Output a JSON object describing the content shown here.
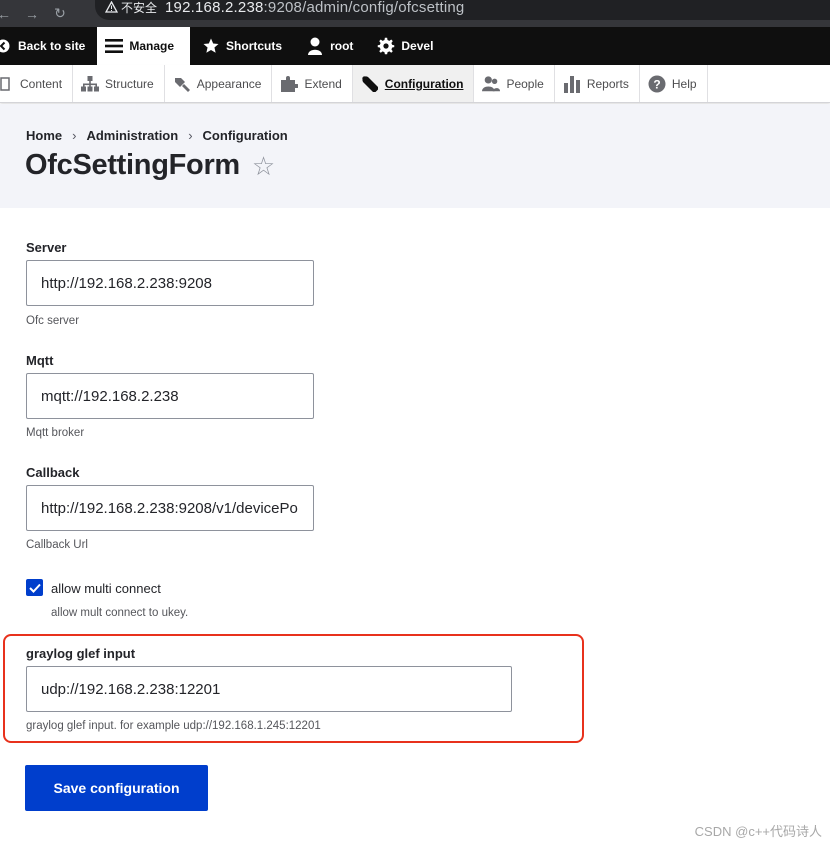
{
  "browser": {
    "security_label": "不安全",
    "url_host": "192.168.2.238",
    "url_path": ":9208/admin/config/ofcsetting"
  },
  "toolbar": {
    "back": "Back to site",
    "manage": "Manage",
    "shortcuts": "Shortcuts",
    "user": "root",
    "devel": "Devel"
  },
  "tray": {
    "items": [
      {
        "label": "Content",
        "icon": "content-icon"
      },
      {
        "label": "Structure",
        "icon": "structure-icon"
      },
      {
        "label": "Appearance",
        "icon": "appearance-icon"
      },
      {
        "label": "Extend",
        "icon": "extend-icon"
      },
      {
        "label": "Configuration",
        "icon": "wrench-icon"
      },
      {
        "label": "People",
        "icon": "people-icon"
      },
      {
        "label": "Reports",
        "icon": "reports-icon"
      },
      {
        "label": "Help",
        "icon": "help-icon"
      }
    ],
    "active": "Configuration"
  },
  "breadcrumb": {
    "home": "Home",
    "sep": "›",
    "administration": "Administration",
    "configuration": "Configuration"
  },
  "page": {
    "title": "OfcSettingForm",
    "star": "☆"
  },
  "form": {
    "server": {
      "label": "Server",
      "value": "http://192.168.2.238:9208",
      "description": "Ofc server"
    },
    "mqtt": {
      "label": "Mqtt",
      "value": "mqtt://192.168.2.238",
      "description": "Mqtt broker"
    },
    "callback": {
      "label": "Callback",
      "value": "http://192.168.2.238:9208/v1/devicePo",
      "description": "Callback Url"
    },
    "multi_connect": {
      "label": "allow multi connect",
      "checked": true,
      "description": "allow mult connect to ukey."
    },
    "graylog": {
      "label": "graylog glef input",
      "value": "udp://192.168.2.238:12201",
      "description": "graylog glef input. for example udp://192.168.1.245:12201"
    },
    "save_label": "Save configuration"
  },
  "watermark": "CSDN @c++代码诗人",
  "colors": {
    "primary": "#003ecc",
    "highlight_border": "#e8311c",
    "toolbar_bg": "#0f0f0f",
    "header_bg": "#f3f4f9"
  }
}
